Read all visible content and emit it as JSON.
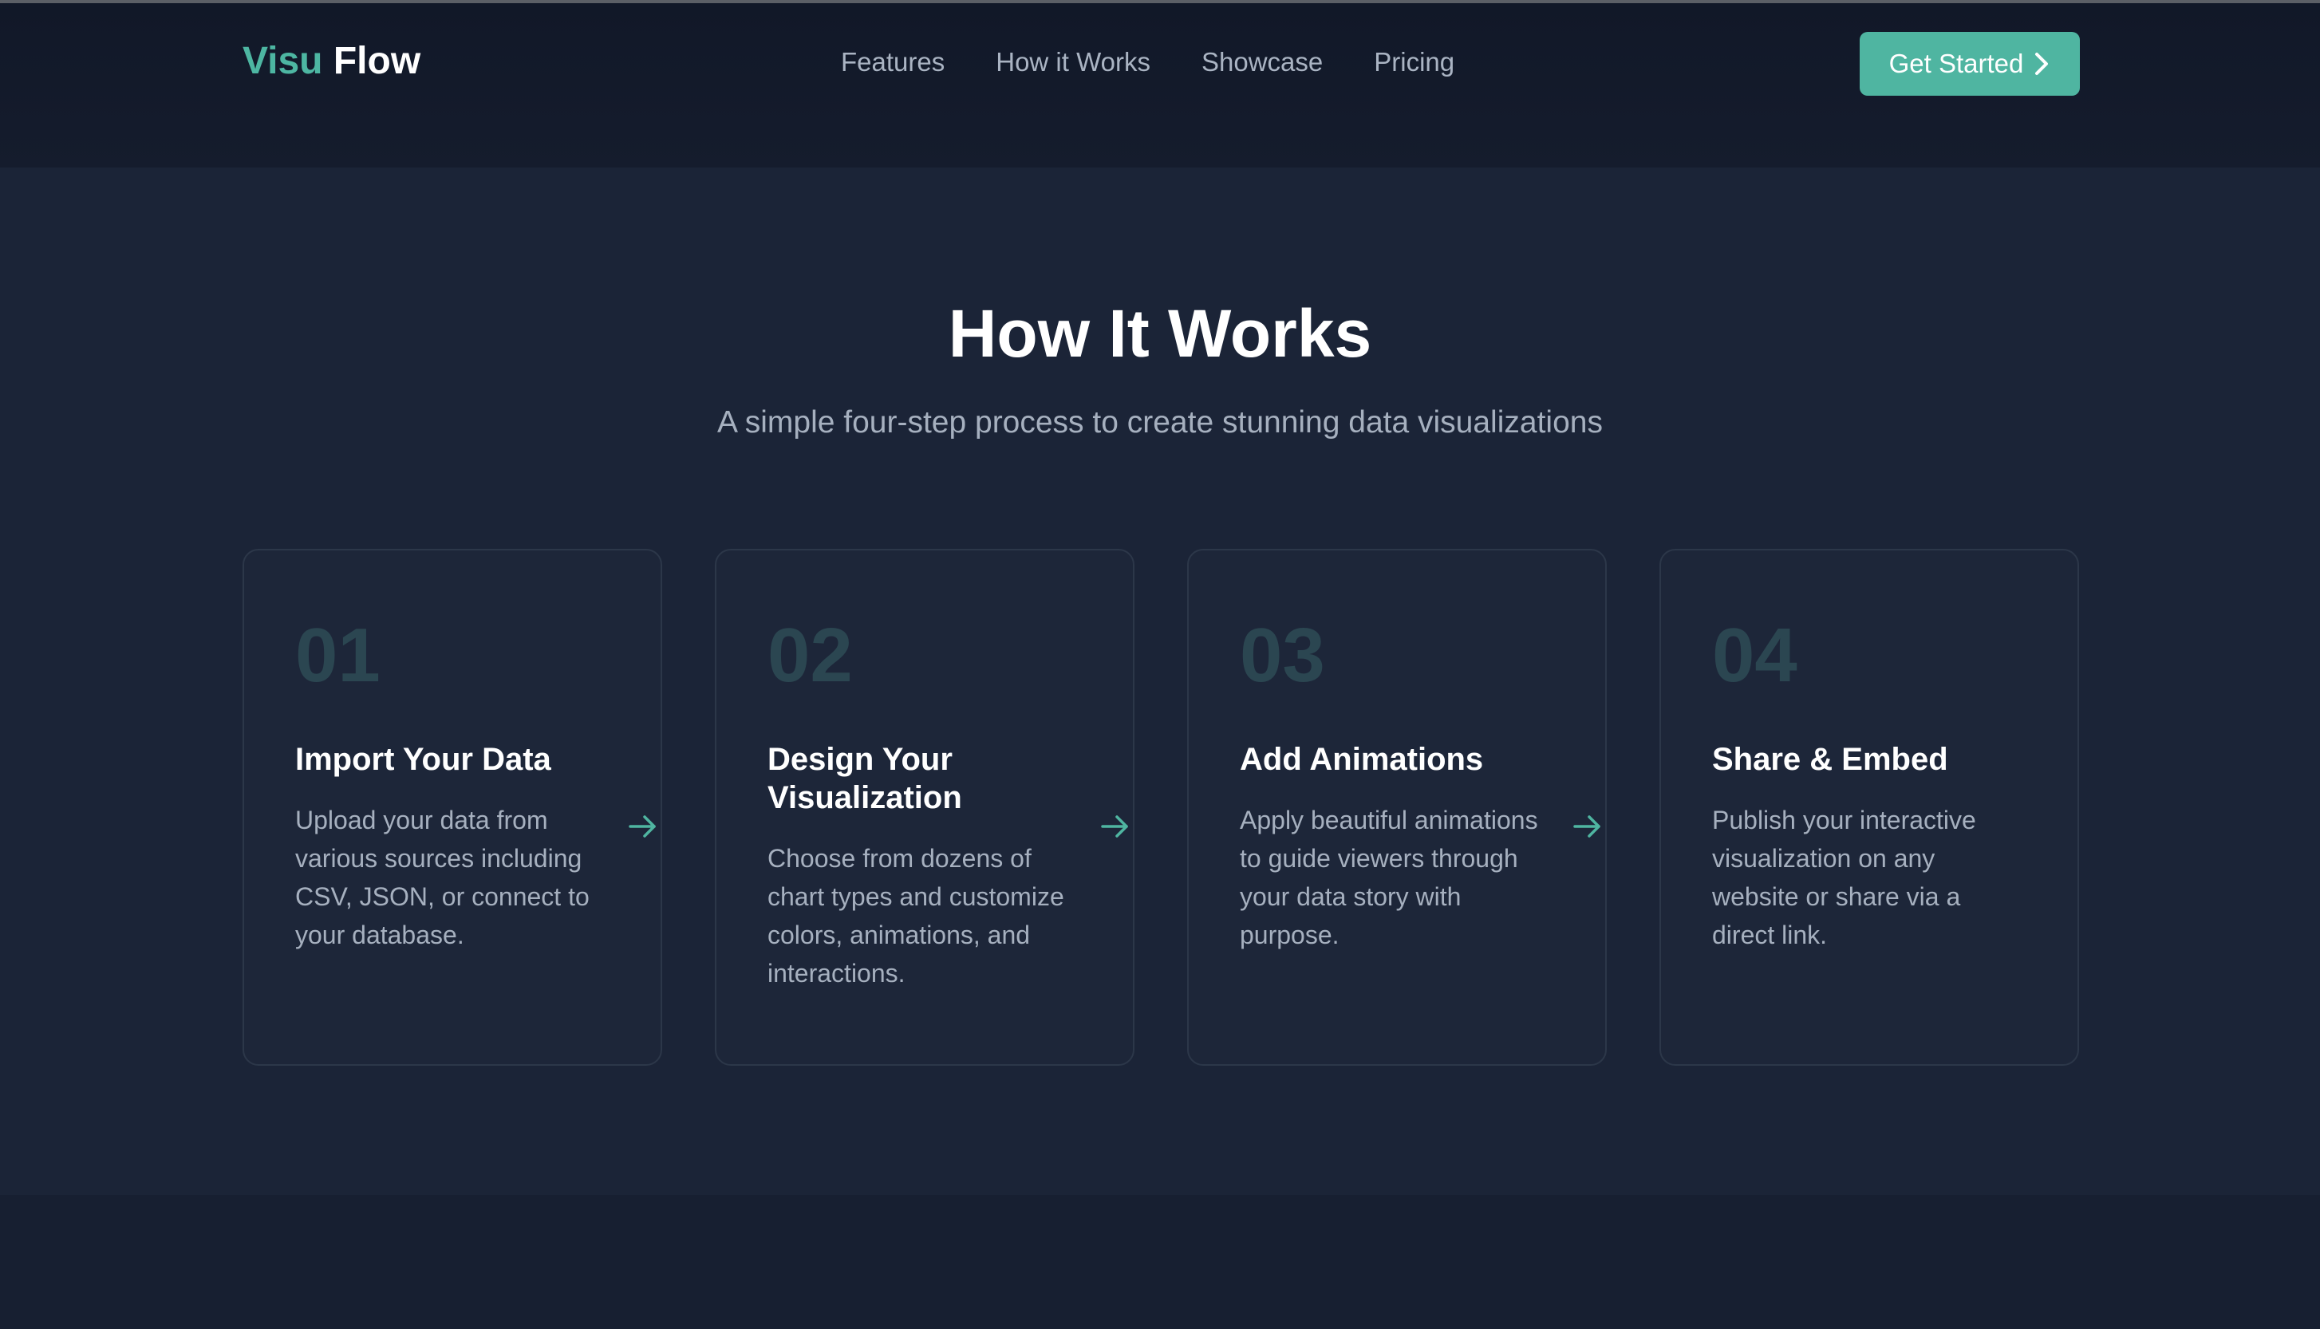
{
  "nav": {
    "logo_first": "Visu",
    "logo_second": "Flow",
    "links": [
      "Features",
      "How it Works",
      "Showcase",
      "Pricing"
    ],
    "cta_label": "Get Started"
  },
  "section": {
    "title": "How It Works",
    "subtitle": "A simple four-step process to create stunning data visualizations"
  },
  "steps": [
    {
      "number": "01",
      "title": "Import Your Data",
      "description": "Upload your data from various sources including CSV, JSON, or connect to your database."
    },
    {
      "number": "02",
      "title": "Design Your Visualization",
      "description": "Choose from dozens of chart types and customize colors, animations, and interactions."
    },
    {
      "number": "03",
      "title": "Add Animations",
      "description": "Apply beautiful animations to guide viewers through your data story with purpose."
    },
    {
      "number": "04",
      "title": "Share & Embed",
      "description": "Publish your interactive visualization on any website or share via a direct link."
    }
  ],
  "icons": {
    "cta": "chevron-right-icon",
    "step_connector": "arrow-right-icon"
  },
  "colors": {
    "accent": "#4fb5a1",
    "background": "#1b2437",
    "step_number": "#2b4651"
  }
}
